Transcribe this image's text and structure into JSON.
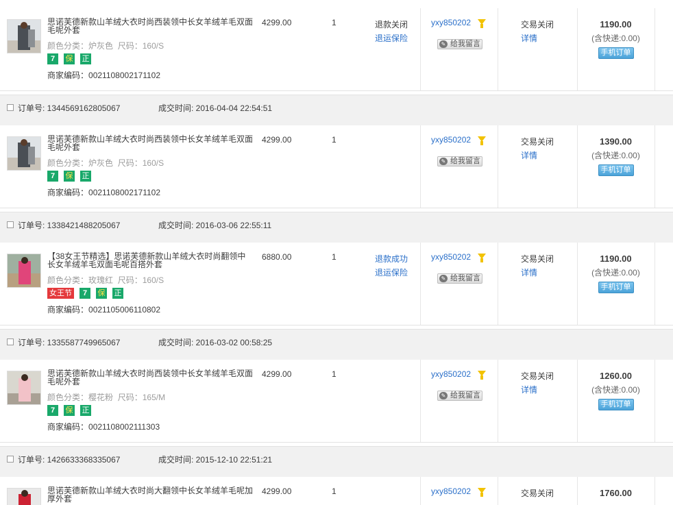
{
  "labels": {
    "order_id_prefix": "订单号: ",
    "time_prefix": "成交时间: ",
    "sku_color": "颜色分类：",
    "sku_size": "尺码：",
    "merchant_code_prefix": "商家编码：",
    "leave_message": "给我留言",
    "mobile_order": "手机订单",
    "details": "详情"
  },
  "colors": {
    "link": "#2a6fc9",
    "header_bg": "#f1f1f1",
    "badge_green": "#19a86a",
    "badge_red": "#e4393c"
  },
  "orders": [
    {
      "order_id": "",
      "time": "",
      "item": {
        "title": "思诺芙德新款山羊绒大衣时尚西装领中长女羊绒羊毛双面毛呢外套",
        "color": "炉灰色",
        "size": "160/S",
        "badges": [
          "7",
          "保",
          "正"
        ],
        "merchant_code": "0021108002171102",
        "price": "4299.00",
        "qty": "1",
        "aftersale_status": "退款关闭",
        "aftersale_link": "退运保险"
      },
      "buyer": "yxy850202",
      "status": "交易关闭",
      "total": "1190.00",
      "shipping": "(含快递:0.00)"
    },
    {
      "order_id": "1344569162805067",
      "time": "2016-04-04 22:54:51",
      "item": {
        "title": "思诺芙德新款山羊绒大衣时尚西装领中长女羊绒羊毛双面毛呢外套",
        "color": "炉灰色",
        "size": "160/S",
        "badges": [
          "7",
          "保",
          "正"
        ],
        "merchant_code": "0021108002171102",
        "price": "4299.00",
        "qty": "1",
        "aftersale_status": "",
        "aftersale_link": ""
      },
      "buyer": "yxy850202",
      "status": "交易关闭",
      "total": "1390.00",
      "shipping": "(含快递:0.00)"
    },
    {
      "order_id": "1338421488205067",
      "time": "2016-03-06 22:55:11",
      "item": {
        "title": "【38女王节精选】思诺芙德新款山羊绒大衣时尚翻领中长女羊绒羊毛双面毛呢百搭外套",
        "color": "玫瑰红",
        "size": "160/S",
        "hot_badge": "女王节",
        "badges": [
          "7",
          "保",
          "正"
        ],
        "merchant_code": "0021105006110802",
        "price": "6880.00",
        "qty": "1",
        "aftersale_status": "退款成功",
        "aftersale_link": "退运保险"
      },
      "buyer": "yxy850202",
      "status": "交易关闭",
      "total": "1190.00",
      "shipping": "(含快递:0.00)"
    },
    {
      "order_id": "1335587749965067",
      "time": "2016-03-02 00:58:25",
      "item": {
        "title": "思诺芙德新款山羊绒大衣时尚西装领中长女羊绒羊毛双面毛呢外套",
        "color": "樱花粉",
        "size": "165/M",
        "badges": [
          "7",
          "保",
          "正"
        ],
        "merchant_code": "0021108002111303",
        "price": "4299.00",
        "qty": "1",
        "aftersale_status": "",
        "aftersale_link": ""
      },
      "buyer": "yxy850202",
      "status": "交易关闭",
      "total": "1260.00",
      "shipping": "(含快递:0.00)"
    },
    {
      "order_id": "1426633368335067",
      "time": "2015-12-10 22:51:21",
      "item": {
        "title": "思诺芙德新款山羊绒大衣时尚大翻领中长女羊绒羊毛呢加厚外套",
        "color": "",
        "size": "",
        "badges": [],
        "merchant_code": "",
        "price": "4299.00",
        "qty": "1",
        "aftersale_status": "",
        "aftersale_link": ""
      },
      "buyer": "yxy850202",
      "status": "交易关闭",
      "total": "1760.00",
      "shipping": ""
    }
  ]
}
